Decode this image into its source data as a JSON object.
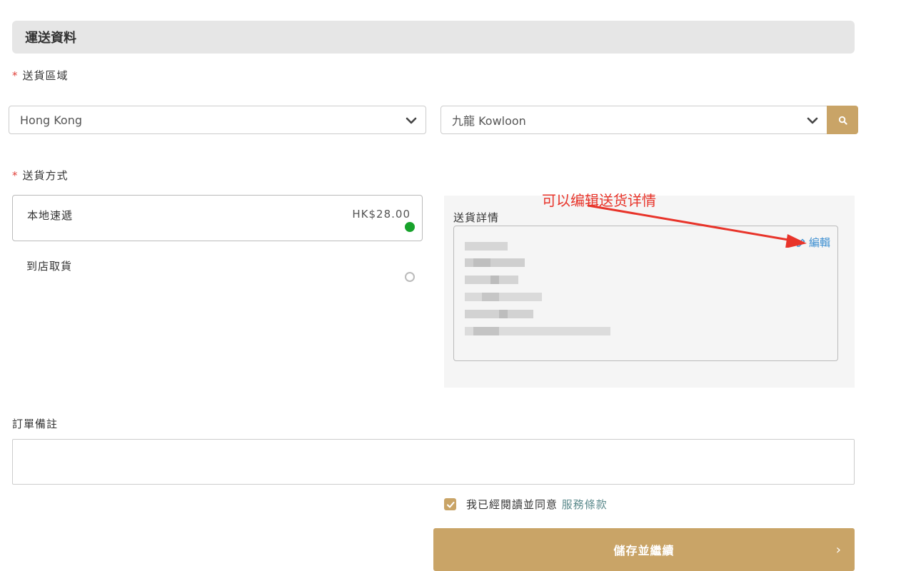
{
  "header": {
    "title": "運送資料"
  },
  "delivery_area": {
    "label": "送貨區域",
    "required_mark": "*",
    "region_value": "Hong Kong",
    "district_value": "九龍 Kowloon"
  },
  "delivery_method": {
    "label": "送貨方式",
    "required_mark": "*",
    "options": [
      {
        "name": "本地速遞",
        "price": "HK$28.00",
        "selected": true
      },
      {
        "name": "到店取貨",
        "price": "",
        "selected": false
      }
    ]
  },
  "delivery_details": {
    "label": "送貨詳情",
    "edit_label": "編輯",
    "annotation": "可以编辑送货详情"
  },
  "order_notes": {
    "label": "訂單備註",
    "value": ""
  },
  "agreement": {
    "text": "我已經閱讀並同意",
    "terms_link": "服務條款",
    "checked": true
  },
  "submit": {
    "label": "儲存並繼續",
    "arrow": "›"
  },
  "colors": {
    "accent_gold": "#c9a467",
    "selected_radio": "#17a22b",
    "required_star": "#e0413a",
    "link_blue": "#3d8fd1",
    "annotation_red": "#e8342a"
  }
}
